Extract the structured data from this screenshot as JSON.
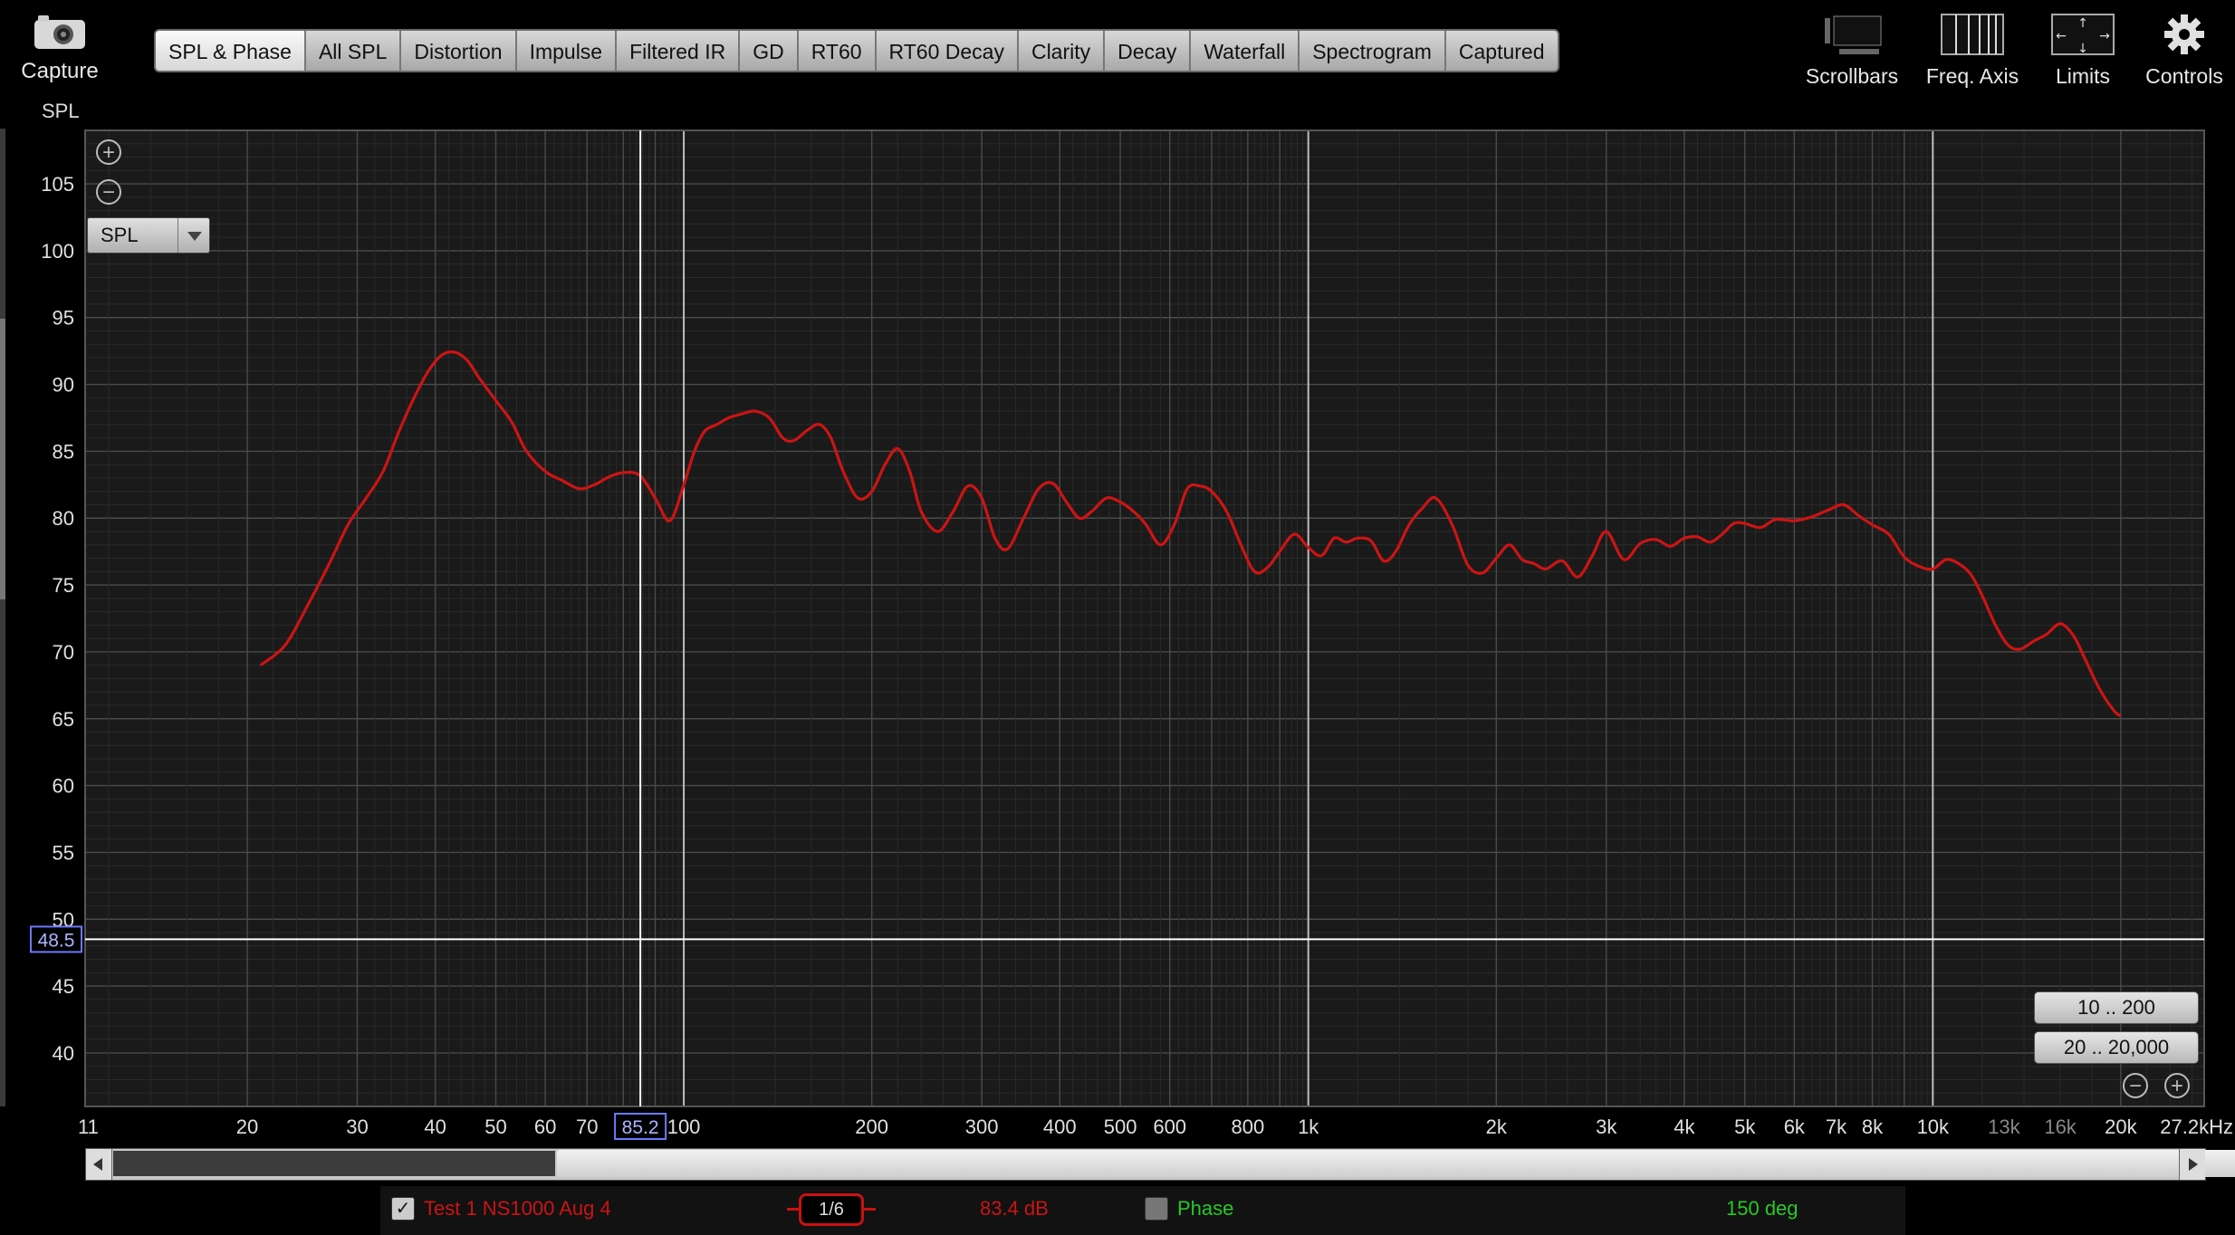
{
  "toolbar": {
    "capture_label": "Capture",
    "tabs": [
      "SPL & Phase",
      "All SPL",
      "Distortion",
      "Impulse",
      "Filtered IR",
      "GD",
      "RT60",
      "RT60 Decay",
      "Clarity",
      "Decay",
      "Waterfall",
      "Spectrogram",
      "Captured"
    ],
    "active_tab": "SPL & Phase",
    "right_tools": [
      {
        "label": "Scrollbars",
        "icon": "scrollbars-icon"
      },
      {
        "label": "Freq. Axis",
        "icon": "freq-axis-icon"
      },
      {
        "label": "Limits",
        "icon": "limits-icon"
      },
      {
        "label": "Controls",
        "icon": "gear-icon"
      }
    ]
  },
  "plot": {
    "y_axis_label": "SPL",
    "selector_value": "SPL",
    "cursor_freq_label": "85.2",
    "cursor_spl_label": "48.5",
    "range_buttons": [
      "10 .. 200",
      "20 .. 20,000"
    ]
  },
  "legend": {
    "trace_name": "Test 1 NS1000 Aug 4",
    "trace_checked": true,
    "smoothing": "1/6",
    "trace_value": "83.4 dB",
    "phase_label": "Phase",
    "phase_checked": false,
    "phase_value": "150 deg"
  },
  "colors": {
    "trace": "#cc1414",
    "phase": "#28c828",
    "background": "#1a1a1a",
    "cursor": "#ffffff"
  },
  "chart_data": {
    "type": "line",
    "title": "",
    "xlabel": "",
    "ylabel": "SPL",
    "x_scale": "log",
    "xlim": [
      11,
      27200
    ],
    "ylim": [
      36,
      109
    ],
    "x_tick_labels": [
      "11",
      "20",
      "30",
      "40",
      "50",
      "60",
      "70",
      "100",
      "200",
      "300",
      "400",
      "500",
      "600",
      "800",
      "1k",
      "2k",
      "3k",
      "4k",
      "5k",
      "6k",
      "7k",
      "8k",
      "10k",
      "13k",
      "16k",
      "20k",
      "27.2kHz"
    ],
    "y_tick_labels": [
      "40",
      "45",
      "50",
      "55",
      "60",
      "65",
      "70",
      "75",
      "80",
      "85",
      "90",
      "95",
      "100",
      "105"
    ],
    "grid": true,
    "cursor": {
      "x": 85.2,
      "y": 48.5
    },
    "series": [
      {
        "name": "Test 1 NS1000 Aug 4",
        "x": [
          21,
          23,
          25,
          27,
          29,
          31,
          33,
          35,
          37,
          39,
          41,
          43,
          45,
          47,
          50,
          53,
          56,
          60,
          64,
          68,
          72,
          76,
          80,
          85,
          90,
          95,
          100,
          104,
          108,
          113,
          118,
          124,
          130,
          137,
          144,
          150,
          158,
          165,
          172,
          180,
          190,
          200,
          210,
          220,
          230,
          240,
          255,
          270,
          285,
          300,
          315,
          330,
          350,
          370,
          390,
          410,
          430,
          450,
          475,
          500,
          525,
          550,
          580,
          610,
          640,
          670,
          700,
          740,
          780,
          820,
          860,
          900,
          950,
          1000,
          1050,
          1100,
          1150,
          1200,
          1260,
          1320,
          1380,
          1450,
          1520,
          1600,
          1700,
          1800,
          1900,
          2000,
          2100,
          2200,
          2300,
          2400,
          2550,
          2700,
          2850,
          3000,
          3200,
          3400,
          3600,
          3800,
          4000,
          4200,
          4400,
          4600,
          4800,
          5000,
          5300,
          5600,
          6000,
          6400,
          6800,
          7200,
          7600,
          8000,
          8500,
          9000,
          9500,
          10000,
          10500,
          11000,
          11500,
          12000,
          12600,
          13200,
          13800,
          14500,
          15200,
          16000,
          16800,
          17600,
          18500,
          19500,
          20000
        ],
        "y": [
          69,
          70.5,
          73.5,
          76.5,
          79.5,
          81.5,
          83.5,
          86.5,
          89,
          91,
          92.2,
          92.4,
          91.8,
          90.5,
          88.8,
          87.2,
          85,
          83.5,
          82.8,
          82.2,
          82.5,
          83.1,
          83.4,
          83.2,
          81.5,
          79.8,
          82.5,
          85,
          86.5,
          87,
          87.5,
          87.8,
          88,
          87.5,
          86,
          85.8,
          86.6,
          87,
          86,
          83.5,
          81.5,
          82,
          84,
          85.2,
          83.5,
          80.5,
          79,
          80.5,
          82.4,
          81.5,
          78.5,
          77.7,
          80,
          82.2,
          82.6,
          81.2,
          80,
          80.5,
          81.5,
          81.2,
          80.5,
          79.5,
          78,
          79.5,
          82.2,
          82.4,
          82,
          80.5,
          78,
          76,
          76.3,
          77.5,
          78.8,
          77.8,
          77.2,
          78.5,
          78.2,
          78.5,
          78.3,
          76.8,
          77.5,
          79.5,
          80.7,
          81.5,
          79.5,
          76.5,
          75.9,
          77,
          78,
          76.9,
          76.6,
          76.2,
          76.8,
          75.6,
          77.2,
          79,
          76.9,
          78.1,
          78.4,
          77.9,
          78.5,
          78.6,
          78.2,
          78.8,
          79.6,
          79.6,
          79.3,
          79.9,
          79.8,
          80.1,
          80.6,
          81,
          80.2,
          79.5,
          78.8,
          77.1,
          76.4,
          76.2,
          76.9,
          76.6,
          75.8,
          74.2,
          72,
          70.5,
          70.2,
          70.8,
          71.3,
          72.1,
          71.2,
          69.3,
          67.2,
          65.6,
          65.2
        ]
      }
    ]
  }
}
